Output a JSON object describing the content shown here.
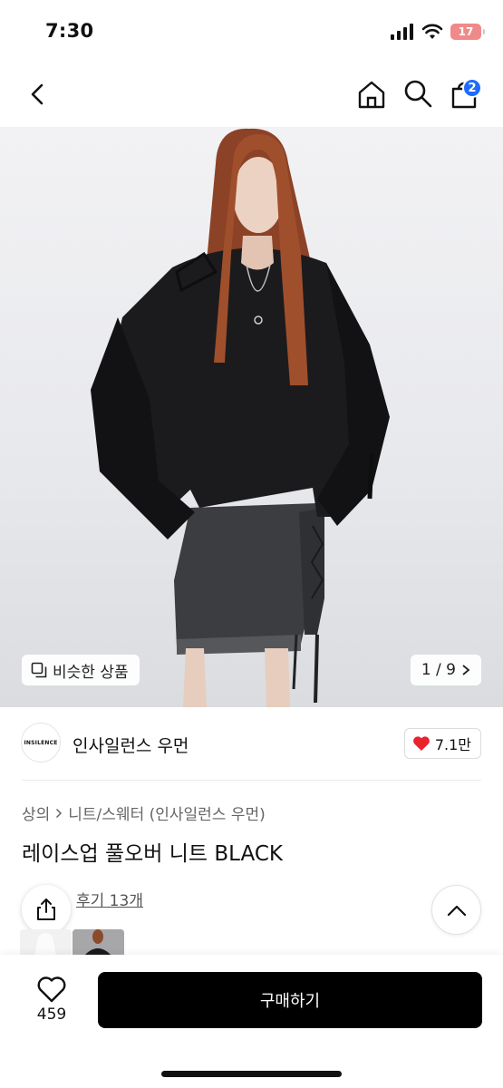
{
  "status_bar": {
    "time": "7:30",
    "battery": "17"
  },
  "nav": {
    "cart_count": "2"
  },
  "hero": {
    "similar_label": "비슷한 상품",
    "page_indicator": "1 / 9"
  },
  "brand": {
    "logo_text": "INSILENCE",
    "name": "인사일런스 우먼",
    "likes": "7.1만"
  },
  "breadcrumb": {
    "category": "상의",
    "subcategory": "니트/스웨터 (인사일런스 우먼)"
  },
  "product": {
    "title": "레이스업 풀오버 니트 BLACK",
    "reviews": "후기 13개"
  },
  "bottom_bar": {
    "wish_count": "459",
    "buy_label": "구매하기"
  },
  "colors": {
    "accent_blue": "#1f6bff",
    "like_red": "#e8232e",
    "buy_button": "#000000"
  }
}
